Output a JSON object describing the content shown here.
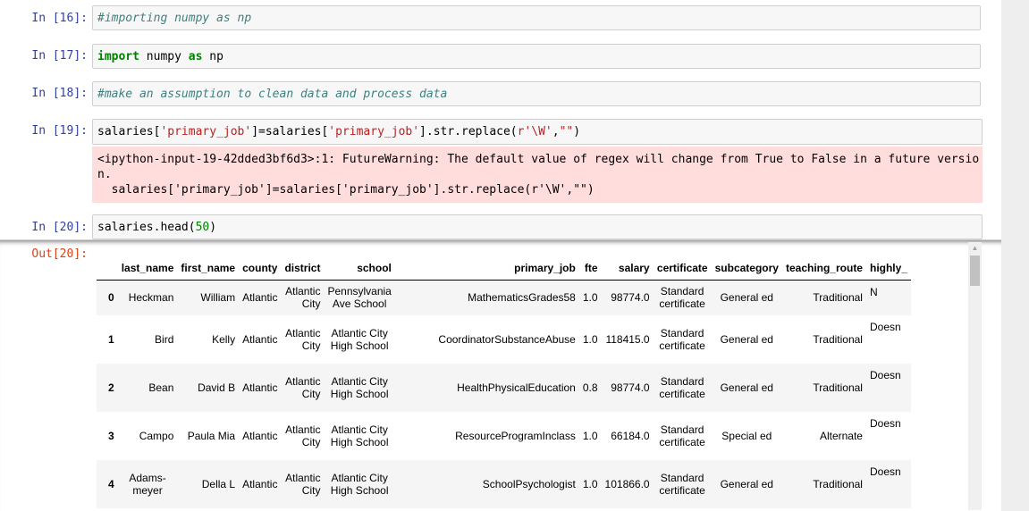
{
  "cells": [
    {
      "prompt": "In [16]:",
      "code": [
        {
          "t": "#importing numpy as np",
          "c": "comment"
        }
      ]
    },
    {
      "prompt": "In [17]:",
      "code": [
        {
          "t": "import",
          "c": "keyword"
        },
        {
          "t": " numpy ",
          "c": ""
        },
        {
          "t": "as",
          "c": "keyword"
        },
        {
          "t": " np",
          "c": ""
        }
      ]
    },
    {
      "prompt": "In [18]:",
      "code": [
        {
          "t": "#make an assumption to clean data and process data",
          "c": "comment"
        }
      ]
    },
    {
      "prompt": "In [19]:",
      "code": [
        {
          "t": "salaries[",
          "c": ""
        },
        {
          "t": "'primary_job'",
          "c": "string"
        },
        {
          "t": "]=salaries[",
          "c": ""
        },
        {
          "t": "'primary_job'",
          "c": "string"
        },
        {
          "t": "].str.replace(",
          "c": ""
        },
        {
          "t": "r'\\W'",
          "c": "string"
        },
        {
          "t": ",",
          "c": ""
        },
        {
          "t": "\"\"",
          "c": "string"
        },
        {
          "t": ")",
          "c": ""
        }
      ]
    },
    {
      "prompt": "In [20]:",
      "code": [
        {
          "t": "salaries.head(",
          "c": ""
        },
        {
          "t": "50",
          "c": "number"
        },
        {
          "t": ")",
          "c": ""
        }
      ]
    }
  ],
  "warning": {
    "line1": "<ipython-input-19-42dded3bf6d3>:1: FutureWarning: The default value of regex will change from True to False in a future versio",
    "line2": "n.",
    "line3": "  salaries['primary_job']=salaries['primary_job'].str.replace(r'\\W',\"\")"
  },
  "output_prompt": "Out[20]:",
  "table": {
    "columns": [
      "",
      "last_name",
      "first_name",
      "county",
      "district",
      "school",
      "primary_job",
      "fte",
      "salary",
      "certificate",
      "subcategory",
      "teaching_route",
      "highly_"
    ],
    "rows": [
      {
        "idx": "0",
        "last_name": "Heckman",
        "first_name": "William",
        "county": "Atlantic",
        "district": "Atlantic City",
        "school": "Pennsylvania Ave School",
        "primary_job": "MathematicsGrades58",
        "fte": "1.0",
        "salary": "98774.0",
        "certificate": "Standard certificate",
        "subcategory": "General ed",
        "teaching_route": "Traditional",
        "highly": "N"
      },
      {
        "idx": "1",
        "last_name": "Bird",
        "first_name": "Kelly",
        "county": "Atlantic",
        "district": "Atlantic City",
        "school": "Atlantic City High School",
        "primary_job": "CoordinatorSubstanceAbuse",
        "fte": "1.0",
        "salary": "118415.0",
        "certificate": "Standard certificate",
        "subcategory": "General ed",
        "teaching_route": "Traditional",
        "highly": "Doesn"
      },
      {
        "idx": "2",
        "last_name": "Bean",
        "first_name": "David B",
        "county": "Atlantic",
        "district": "Atlantic City",
        "school": "Atlantic City High School",
        "primary_job": "HealthPhysicalEducation",
        "fte": "0.8",
        "salary": "98774.0",
        "certificate": "Standard certificate",
        "subcategory": "General ed",
        "teaching_route": "Traditional",
        "highly": "Doesn"
      },
      {
        "idx": "3",
        "last_name": "Campo",
        "first_name": "Paula Mia",
        "county": "Atlantic",
        "district": "Atlantic City",
        "school": "Atlantic City High School",
        "primary_job": "ResourceProgramInclass",
        "fte": "1.0",
        "salary": "66184.0",
        "certificate": "Standard certificate",
        "subcategory": "Special ed",
        "teaching_route": "Alternate",
        "highly": "Doesn"
      },
      {
        "idx": "4",
        "last_name": "Adams-meyer",
        "first_name": "Della L",
        "county": "Atlantic",
        "district": "Atlantic City",
        "school": "Atlantic City High School",
        "primary_job": "SchoolPsychologist",
        "fte": "1.0",
        "salary": "101866.0",
        "certificate": "Standard certificate",
        "subcategory": "General ed",
        "teaching_route": "Traditional",
        "highly": "Doesn"
      }
    ]
  },
  "scrollbar": {
    "up_arrow_icon": "▲"
  }
}
